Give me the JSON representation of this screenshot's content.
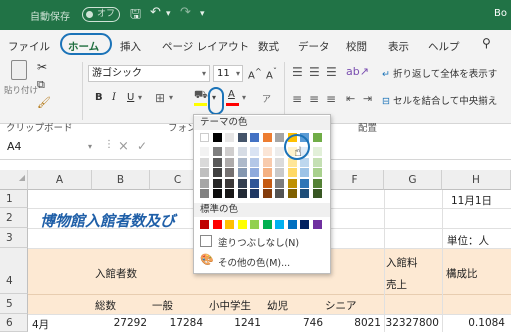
{
  "titlebar": {
    "autosave_label": "自動保存",
    "autosave_state": "オフ",
    "book_label": "Bo"
  },
  "tabs": [
    {
      "label": "ファイル",
      "active": false
    },
    {
      "label": "ホーム",
      "active": true
    },
    {
      "label": "挿入",
      "active": false
    },
    {
      "label": "ページ レイアウト",
      "active": false
    },
    {
      "label": "数式",
      "active": false
    },
    {
      "label": "データ",
      "active": false
    },
    {
      "label": "校閲",
      "active": false
    },
    {
      "label": "表示",
      "active": false
    },
    {
      "label": "ヘルプ",
      "active": false
    }
  ],
  "ribbon": {
    "paste_label": "貼り付け",
    "clipboard_group": "クリップボード",
    "font_name": "游ゴシック",
    "font_size": "11",
    "font_group": "フォント",
    "align_group": "配置",
    "wrap_text": "折り返して全体を表示す",
    "merge_center": "セルを結合して中央揃え"
  },
  "formula_bar": {
    "name_box": "A4"
  },
  "columns": [
    "A",
    "B",
    "C",
    "F",
    "G",
    "H"
  ],
  "rows": [
    "1",
    "2",
    "3",
    "4",
    "5",
    "6"
  ],
  "sheet": {
    "h1": "11月1日",
    "a2": "博物館入館者数及び",
    "h3": "単位：人",
    "b4": "入館者数",
    "g4a": "入館料",
    "g4b": "売上",
    "h4": "構成比",
    "b5": "総数",
    "c5": "一般",
    "d5": "小中学生",
    "e5": "幼児",
    "f5": "シニア",
    "a6": "4月",
    "b6": "27292",
    "c6": "17284",
    "d6": "1241",
    "e6": "746",
    "f6": "8021",
    "g6": "32327800",
    "h6": "0.1084"
  },
  "color_menu": {
    "theme_label": "テーマの色",
    "standard_label": "標準の色",
    "no_fill": "塗りつぶしなし(N)",
    "more_colors": "その他の色(M)...",
    "theme_top": [
      "#ffffff",
      "#000000",
      "#e7e6e6",
      "#44546a",
      "#4472c4",
      "#ed7d31",
      "#a5a5a5",
      "#ffc000",
      "#5b9bd5",
      "#70ad47"
    ],
    "theme_shades": [
      [
        "#f2f2f2",
        "#7f7f7f",
        "#d0cece",
        "#d6dce5",
        "#dae3f3",
        "#fbe5d6",
        "#ededed",
        "#fff2cc",
        "#deebf7",
        "#e2f0d9"
      ],
      [
        "#d9d9d9",
        "#595959",
        "#aeabab",
        "#adb9ca",
        "#b4c7e7",
        "#f8cbad",
        "#dbdbdb",
        "#ffe699",
        "#bdd7ee",
        "#c5e0b4"
      ],
      [
        "#bfbfbf",
        "#404040",
        "#757171",
        "#8497b0",
        "#8faadc",
        "#f4b183",
        "#c9c9c9",
        "#ffd966",
        "#9dc3e6",
        "#a9d18e"
      ],
      [
        "#a6a6a6",
        "#262626",
        "#3b3838",
        "#333f50",
        "#2f5597",
        "#c55a11",
        "#7b7b7b",
        "#bf9000",
        "#2e75b6",
        "#548235"
      ],
      [
        "#808080",
        "#0d0d0d",
        "#171616",
        "#222a35",
        "#1f3864",
        "#843c0c",
        "#525252",
        "#7f6000",
        "#1f4e79",
        "#385723"
      ]
    ],
    "standard": [
      "#c00000",
      "#ff0000",
      "#ffc000",
      "#ffff00",
      "#92d050",
      "#00b050",
      "#00b0f0",
      "#0070c0",
      "#002060",
      "#7030a0"
    ]
  }
}
